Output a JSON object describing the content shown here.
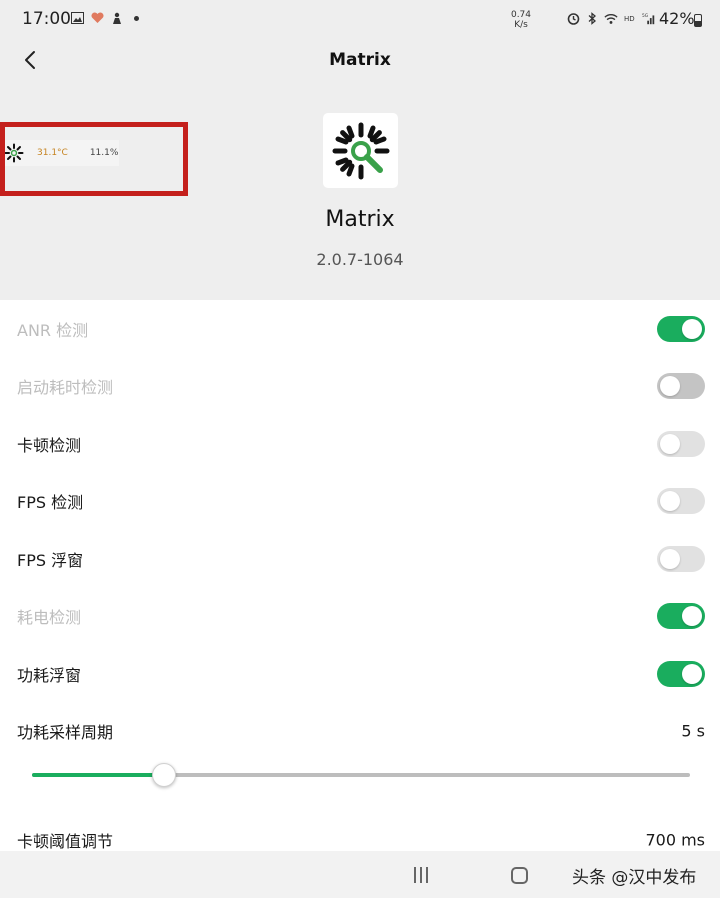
{
  "status_bar": {
    "time": "17:00",
    "net_speed_value": "0.74",
    "net_speed_unit": "K/s",
    "battery": "42%"
  },
  "header": {
    "title": "Matrix"
  },
  "floating_window": {
    "temperature": "31.1°C",
    "percent": "11.1%"
  },
  "app": {
    "name": "Matrix",
    "version": "2.0.7-1064"
  },
  "settings": [
    {
      "label": "ANR 检测",
      "toggle": true,
      "enabled": false
    },
    {
      "label": "启动耗时检测",
      "toggle": false,
      "enabled": false
    },
    {
      "label": "卡顿检测",
      "toggle": false,
      "enabled": true
    },
    {
      "label": "FPS 检测",
      "toggle": false,
      "enabled": true
    },
    {
      "label": "FPS 浮窗",
      "toggle": false,
      "enabled": true
    },
    {
      "label": "耗电检测",
      "toggle": true,
      "enabled": false
    },
    {
      "label": "功耗浮窗",
      "toggle": true,
      "enabled": true
    }
  ],
  "sampling": {
    "label": "功耗采样周期",
    "value": "5 s",
    "slider_fraction": 0.2
  },
  "threshold": {
    "label": "卡顿阈值调节",
    "value": "700 ms"
  },
  "watermark": "头条 @汉中发布",
  "colors": {
    "accent": "#1aad5e",
    "highlight_box": "#c4201c",
    "header_bg": "#eeeeee"
  }
}
